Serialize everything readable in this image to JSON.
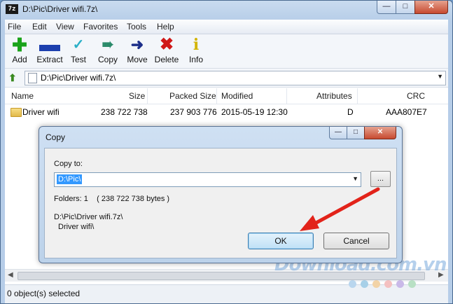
{
  "window": {
    "title": "D:\\Pic\\Driver wifi.7z\\",
    "icon_text": "7z"
  },
  "menu": [
    "File",
    "Edit",
    "View",
    "Favorites",
    "Tools",
    "Help"
  ],
  "toolbar": [
    {
      "label": "Add",
      "icon": "plus-icon",
      "color": "#1aa31a"
    },
    {
      "label": "Extract",
      "icon": "minus-icon",
      "color": "#1c3fae"
    },
    {
      "label": "Test",
      "icon": "check-icon",
      "color": "#2bb0c7"
    },
    {
      "label": "Copy",
      "icon": "double-arrow-icon",
      "color": "#2a8a6a"
    },
    {
      "label": "Move",
      "icon": "arrow-right-icon",
      "color": "#1c2f8a"
    },
    {
      "label": "Delete",
      "icon": "x-icon",
      "color": "#d01818"
    },
    {
      "label": "Info",
      "icon": "info-icon",
      "color": "#d3b400"
    }
  ],
  "address": {
    "path": "D:\\Pic\\Driver wifi.7z\\"
  },
  "columns": {
    "name": "Name",
    "size": "Size",
    "packed": "Packed Size",
    "modified": "Modified",
    "attributes": "Attributes",
    "crc": "CRC"
  },
  "rows": [
    {
      "name": "Driver wifi",
      "size": "238 722 738",
      "packed": "237 903 776",
      "modified": "2015-05-19 12:30",
      "attributes": "D",
      "crc": "AAA807E7"
    }
  ],
  "status": "0 object(s) selected",
  "dialog": {
    "title": "Copy",
    "copy_to_label": "Copy to:",
    "copy_to_value": "D:\\Pic\\",
    "browse_label": "...",
    "folders_info": "Folders: 1    ( 238 722 738 bytes )",
    "source_path": "D:\\Pic\\Driver wifi.7z\\",
    "source_item": "Driver wifi\\",
    "ok_label": "OK",
    "cancel_label": "Cancel"
  },
  "watermark": "Download.com.vn",
  "colors": {
    "arrow": "#e2231a",
    "selection": "#3399ff",
    "title_bar": "#b6cde8"
  }
}
